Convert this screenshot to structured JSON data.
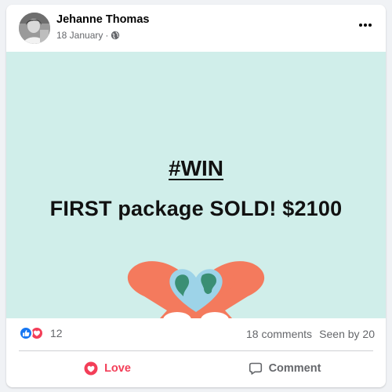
{
  "post": {
    "author": "Jehanne Thomas",
    "date": "18 January",
    "meta_separator": "·",
    "privacy_icon": "globe-icon",
    "more_icon": "more-options-icon"
  },
  "image": {
    "hashtag": "#WIN",
    "headline": "FIRST package SOLD! $2100",
    "background_color": "#d0eeea",
    "hands_color": "#f47a5d",
    "globe_ocean_color": "#9dd3e8",
    "globe_land_color": "#3a8f74"
  },
  "stats": {
    "reaction_icons": [
      "like-icon",
      "love-icon"
    ],
    "reactions_count": "12",
    "comments": "18 comments",
    "seen_by": "Seen by 20"
  },
  "actions": {
    "love_label": "Love",
    "comment_label": "Comment",
    "love_color": "#f33e58"
  }
}
